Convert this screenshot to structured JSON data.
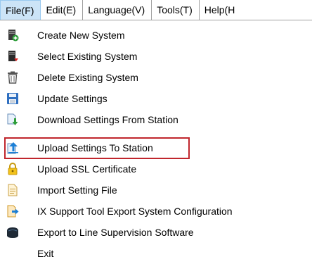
{
  "menubar": {
    "items": [
      {
        "label": "File(F)"
      },
      {
        "label": "Edit(E)"
      },
      {
        "label": "Language(V)"
      },
      {
        "label": "Tools(T)"
      },
      {
        "label": "Help(H"
      }
    ]
  },
  "file_menu": {
    "items": [
      {
        "label": "Create New System",
        "icon": "create-system-icon"
      },
      {
        "label": "Select Existing System",
        "icon": "select-system-icon"
      },
      {
        "label": "Delete Existing System",
        "icon": "trash-icon"
      },
      {
        "label": "Update Settings",
        "icon": "save-disk-icon"
      },
      {
        "label": "Download Settings From Station",
        "icon": "download-icon"
      },
      {
        "label": "Upload Settings To Station",
        "icon": "upload-icon"
      },
      {
        "label": "Upload SSL Certificate",
        "icon": "lock-icon"
      },
      {
        "label": "Import Setting File",
        "icon": "import-file-icon"
      },
      {
        "label": "IX Support Tool Export System Configuration",
        "icon": "export-config-icon"
      },
      {
        "label": "Export to Line Supervision Software",
        "icon": "export-line-icon"
      },
      {
        "label": "Exit",
        "icon": ""
      }
    ],
    "highlighted_item": "Upload Settings To Station"
  },
  "colors": {
    "highlight_border": "#c0262d",
    "active_menu_bg": "#cce4f7"
  }
}
